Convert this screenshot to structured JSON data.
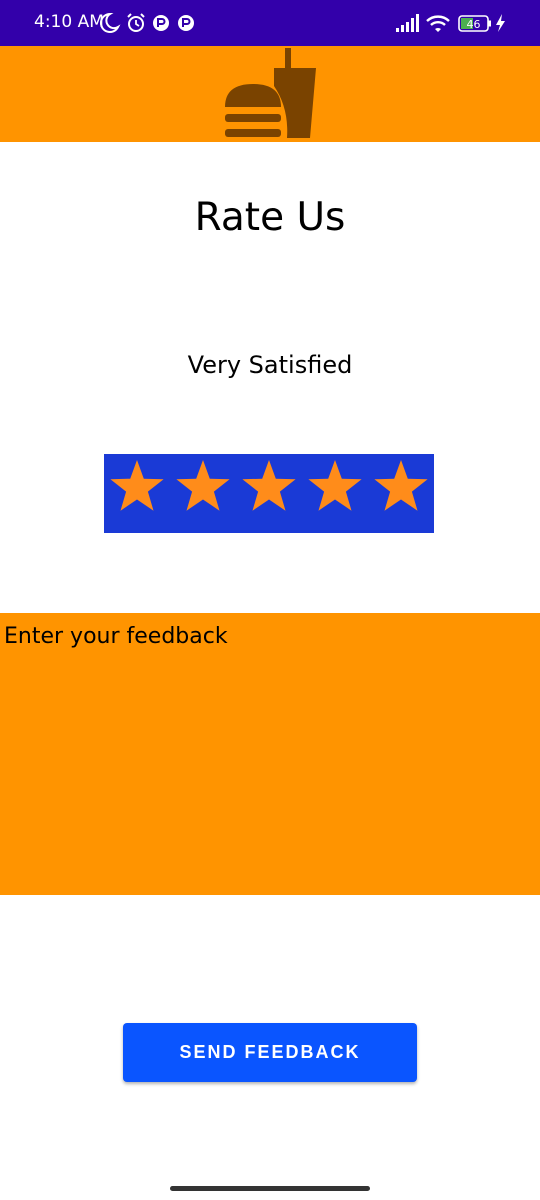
{
  "status_bar": {
    "time": "4:10 AM",
    "battery_level": "46",
    "background": "#3300aa",
    "icons_left": [
      "moon-icon",
      "alarm-icon",
      "notification-icon",
      "notification-icon"
    ],
    "icons_right": [
      "signal-icon",
      "wifi-icon",
      "battery-icon",
      "charging-icon"
    ]
  },
  "app_bar": {
    "background": "#ff9400",
    "logo_icon": "burger-drink-icon"
  },
  "main": {
    "title": "Rate Us",
    "rating_label": "Very Satisfied",
    "rating": {
      "value": 5,
      "max": 5
    },
    "feedback_placeholder": "Enter your feedback",
    "send_label": "SEND FEEDBACK"
  },
  "colors": {
    "accent_orange": "#ff9400",
    "rating_background": "#1a3ad6",
    "star_fill": "#ff8c1a",
    "button": "#0a55ff"
  }
}
